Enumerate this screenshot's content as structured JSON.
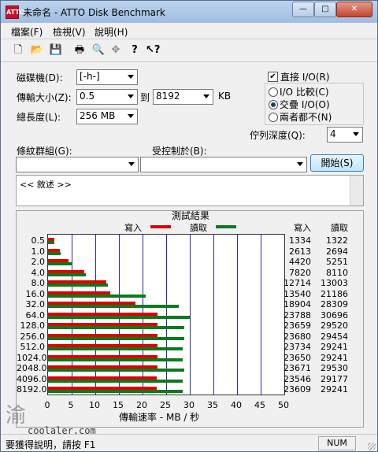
{
  "window": {
    "title": "未命名 - ATTO Disk Benchmark",
    "icon_text": "ATTO"
  },
  "titlebar_buttons": {
    "minimize": "—",
    "maximize": "□",
    "close": "✕"
  },
  "menu": [
    "檔案(F)",
    "檢視(V)",
    "說明(H)"
  ],
  "toolbar_icons": [
    "new-icon",
    "open-icon",
    "save-icon",
    "print-icon",
    "print-preview-icon",
    "move-icon",
    "help-icon",
    "context-help-icon"
  ],
  "form": {
    "drive_label": "磁碟機(D):",
    "drive_value": "[-h-]",
    "transfer_label": "傳輸大小(Z):",
    "transfer_from": "0.5",
    "to_label": "到",
    "transfer_to": "8192",
    "kb_label": "KB",
    "length_label": "總長度(L):",
    "length_value": "256 MB",
    "direct_io_label": "直接 I/O(R)",
    "direct_io_checked": true,
    "io_compare_label": "I/O 比較(C)",
    "overlapped_io_label": "交疊 I/O(O)",
    "neither_label": "兩者都不(N)",
    "queue_label": "佇列深度(Q):",
    "queue_value": "4",
    "controlled_by_label": "條紋群組(G):",
    "controlled_by_value": "",
    "restricted_to_label": "受控制於(B):",
    "restricted_to_value": "",
    "start_button": "開始(S)",
    "description_text": "<< 敘述 >>"
  },
  "results": {
    "title": "測試結果",
    "legend_write": "寫入",
    "legend_read": "讀取",
    "col_write": "寫入",
    "col_read": "讀取",
    "xlabel": "傳輸速率 - MB / 秒",
    "write_color": "#e00000",
    "read_color": "#0a7a1a"
  },
  "chart_data": {
    "type": "bar",
    "orientation": "horizontal",
    "categories": [
      "0.5",
      "1.0",
      "2.0",
      "4.0",
      "8.0",
      "16.0",
      "32.0",
      "64.0",
      "128.0",
      "256.0",
      "512.0",
      "1024.0",
      "2048.0",
      "4096.0",
      "8192.0"
    ],
    "series": [
      {
        "name": "寫入",
        "values": [
          1334,
          2613,
          4420,
          7820,
          12714,
          13540,
          18904,
          23788,
          23659,
          23680,
          23734,
          23650,
          23671,
          23546,
          23609
        ]
      },
      {
        "name": "讀取",
        "values": [
          1322,
          2694,
          5251,
          8110,
          13003,
          21186,
          28309,
          30696,
          29520,
          29454,
          29241,
          29241,
          29530,
          29177,
          29241
        ]
      }
    ],
    "value_scale": "KB/s",
    "xlabel": "傳輸速率 - MB / 秒",
    "xticks": [
      0,
      5,
      10,
      15,
      20,
      25,
      30,
      35,
      40,
      45,
      50
    ],
    "xlim": [
      0,
      50
    ],
    "grid": true,
    "legend": "top-center"
  },
  "status": {
    "help_text": "要獲得說明，請按 F1",
    "num_indicator": "NUM"
  },
  "watermark": {
    "glyph": "渝",
    "site": "coolaler.com"
  }
}
